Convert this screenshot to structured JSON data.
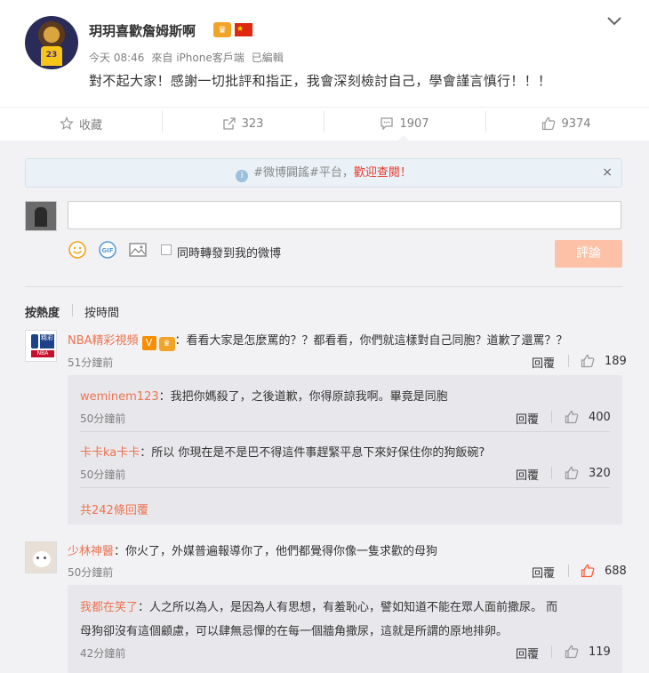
{
  "post": {
    "username": "玥玥喜歡詹姆斯啊",
    "time": "今天 08:46",
    "source": "來自 iPhone客戶端",
    "edited": "已編輯",
    "text": "對不起大家！感謝一切批評和指正，我會深刻檢討自己，學會謹言慎行！！！"
  },
  "actions": {
    "favorite": "收藏",
    "repost": "323",
    "comment": "1907",
    "like": "9374"
  },
  "comment_panel": {
    "notice_tag": "#微博闢謠#平台，",
    "notice_link": "歡迎查閱！",
    "close": "×",
    "repost_checkbox_label": "同時轉發到我的微博",
    "submit_label": "評論",
    "sort_hot": "按熱度",
    "sort_time": "按時間"
  },
  "comments": [
    {
      "name": "NBA精彩視頻",
      "text": "：看看大家是怎麼罵的？？都看看，你們就這樣對自己同胞？道歉了還罵？？",
      "time": "51分鐘前",
      "reply": "回覆",
      "likes": "189",
      "replies": [
        {
          "name": "weminem123",
          "text": "：我把你媽殺了，之後道歉，你得原諒我啊。畢竟是同胞",
          "time": "50分鐘前",
          "reply": "回覆",
          "likes": "400"
        },
        {
          "name": "卡卡ka卡卡",
          "text": "：所以 你現在是不是巴不得這件事趕緊平息下來好保住你的狗飯碗?",
          "time": "50分鐘前",
          "reply": "回覆",
          "likes": "320"
        }
      ],
      "more": "共242條回覆"
    },
    {
      "name": "少林神醫",
      "text": "：你火了，外媒普遍報導你了，他們都覺得你像一隻求歡的母狗",
      "time": "50分鐘前",
      "reply": "回覆",
      "likes": "688",
      "replies": [
        {
          "name": "我都在笑了",
          "text": "：人之所以為人，是因為人有思想，有羞恥心，譬如知道不能在眾人面前撒尿。 而",
          "text2": "母狗卻沒有這個顧慮，可以肆無忌憚的在每一個牆角撒尿，這就是所謂的原地排卵。",
          "time": "42分鐘前",
          "reply": "回覆",
          "likes": "119"
        }
      ]
    }
  ],
  "colors": {
    "accent": "#eb7350",
    "submit_disabled": "#fcc1a6",
    "liked": "#ff5c38"
  },
  "icons": [
    "chevron-down-icon",
    "star-icon",
    "share-icon",
    "comment-icon",
    "thumbs-up-icon",
    "info-icon",
    "emoji-icon",
    "gif-icon",
    "image-icon"
  ]
}
